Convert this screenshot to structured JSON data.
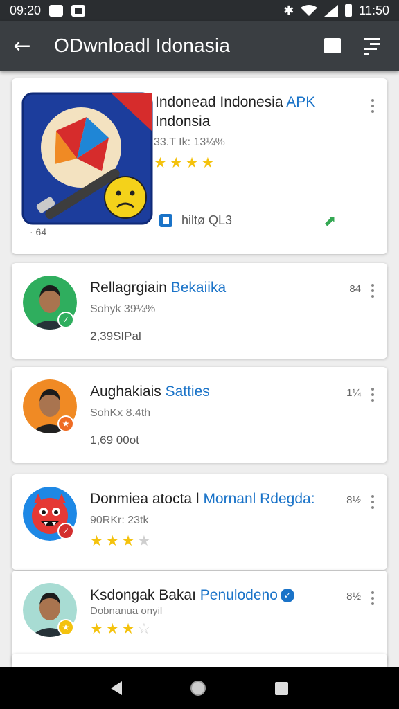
{
  "status_bar": {
    "time": "09:20",
    "bluetooth": "✱",
    "time_right": "11:50"
  },
  "app_bar": {
    "back_glyph": "←",
    "title": "ODwnloadl Idonasia"
  },
  "featured": {
    "name": "Indonead Indonesia",
    "name_highlight": "APK",
    "name_line2": "Indonsia",
    "meta": "33.T Ik: 13¼%",
    "rating": 4,
    "sublabel": "hiltø QL3",
    "small_label": "· 64",
    "download_glyph": "⬈"
  },
  "apps": [
    {
      "name": "Rellagrgiain",
      "highlight": "Bekaiika",
      "meta": "Sohyk 39¼%",
      "downloads": "2,39SIPal",
      "size": "84",
      "rating": null,
      "avatar_color": "#2fae5e",
      "badge_color": "#2fae5e",
      "badge_glyph": "✓"
    },
    {
      "name": "Aughakiais",
      "highlight": "Satties",
      "meta": "SohKx 8.4th",
      "downloads": "1,69 00ot",
      "size": "1¼",
      "rating": null,
      "avatar_color": "#f08a24",
      "badge_color": "#ef6c24",
      "badge_glyph": "★"
    },
    {
      "name": "Donmiea atocta l",
      "highlight": "Mornanl Rdegda:",
      "meta": "90RKr: 23tk",
      "downloads": "",
      "size": "8½",
      "rating": 3,
      "avatar_color": "#1e88e5",
      "badge_color": "#d32f2f",
      "badge_glyph": "✓"
    },
    {
      "name": "Ksdongak Bakaı",
      "highlight": "Penulodeno",
      "meta": "Dobnanua onyil",
      "downloads": "",
      "size": "8½",
      "rating": 3,
      "avatar_color": "#a8dcd3",
      "badge_color": "#f4c20d",
      "badge_glyph": "★"
    }
  ],
  "nav": {
    "back": "back-button",
    "home": "home-button",
    "recent": "recents-button"
  }
}
